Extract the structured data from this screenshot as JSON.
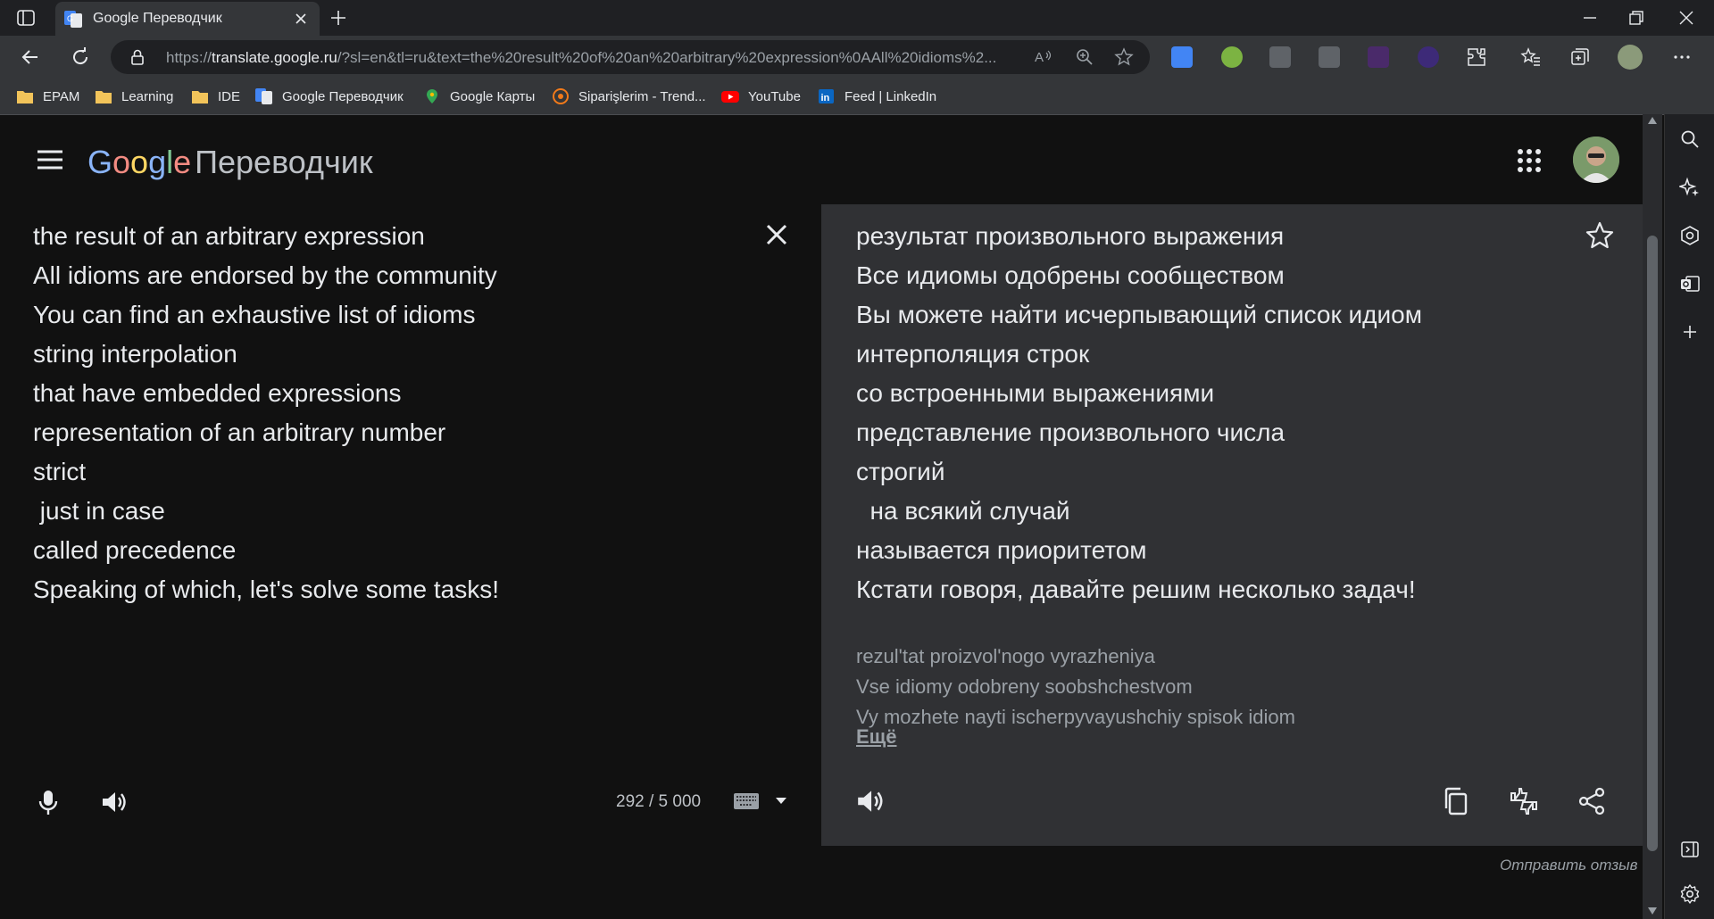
{
  "browser": {
    "tab_title": "Google Переводчик",
    "url_prefix": "https://",
    "url_host": "translate.google.ru",
    "url_rest": "/?sl=en&tl=ru&text=the%20result%20of%20an%20arbitrary%20expression%0AAll%20idioms%2...",
    "bookmarks": [
      {
        "label": "EPAM",
        "icon": "folder-icon"
      },
      {
        "label": "Learning",
        "icon": "folder-icon"
      },
      {
        "label": "IDE",
        "icon": "folder-icon"
      },
      {
        "label": "Google Переводчик",
        "icon": "google-translate-icon"
      },
      {
        "label": "Google Карты",
        "icon": "google-maps-icon"
      },
      {
        "label": "Siparişlerim - Trend...",
        "icon": "trendyol-icon"
      },
      {
        "label": "YouTube",
        "icon": "youtube-icon"
      },
      {
        "label": "Feed | LinkedIn",
        "icon": "linkedin-icon"
      }
    ]
  },
  "app": {
    "logo_google": "Google",
    "logo_product": "Переводчик"
  },
  "source": {
    "lines": [
      "the result of an arbitrary expression",
      "All idioms are endorsed by the community",
      "You can find an exhaustive list of idioms",
      "string interpolation",
      "that have embedded expressions",
      "representation of an arbitrary number",
      "strict",
      " just in case",
      "called precedence",
      "Speaking of which, let's solve some tasks!"
    ],
    "char_count": "292 / 5 000"
  },
  "target": {
    "lines": [
      "результат произвольного выражения",
      "Все идиомы одобрены сообществом",
      "Вы можете найти исчерпывающий список идиом",
      "интерполяция строк",
      "со встроенными выражениями",
      "представление произвольного числа",
      "строгий",
      "  на всякий случай",
      "называется приоритетом",
      "Кстати говоря, давайте решим несколько задач!"
    ],
    "transliteration": [
      "rezul'tat proizvol'nogo vyrazheniya",
      "Vse idiomy odobreny soobshchestvom",
      "Vy mozhete nayti ischerpyvayushchiy spisok idiom"
    ],
    "more_label": "Ещё"
  },
  "footer": {
    "feedback_label": "Отправить отзыв"
  },
  "colors": {
    "background": "#111111",
    "target_panel": "#303134",
    "text": "#e8eaed",
    "muted": "#9aa0a6"
  }
}
